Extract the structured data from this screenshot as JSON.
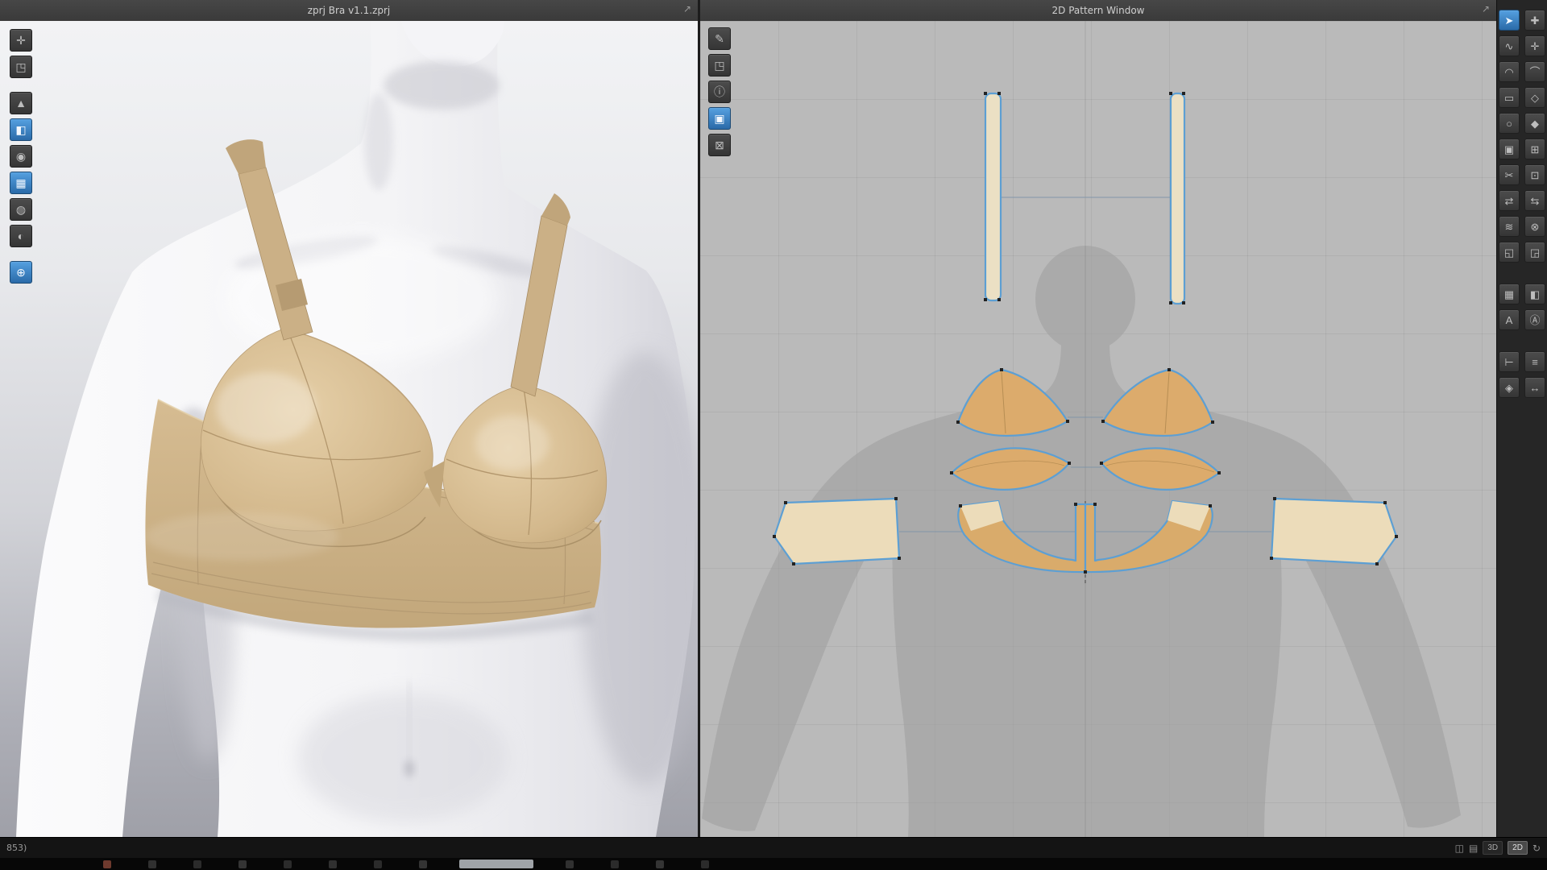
{
  "window": {
    "left_panel_title": "zprj Bra v1.1.zprj",
    "right_panel_title": "2D Pattern Window",
    "popout_glyph": "↗"
  },
  "statusbar": {
    "left_text": "853)",
    "layout_icon_1": "◫",
    "layout_icon_2": "▤",
    "view_3d": {
      "label": "3D",
      "active": false
    },
    "view_2d": {
      "label": "2D",
      "active": true
    },
    "refresh_glyph": "↻"
  },
  "colors": {
    "accent_blue": "#5d9fd3",
    "pattern_light": "#ecdcba",
    "pattern_dark": "#d9ab6b",
    "bra_band": "#cdb287",
    "skin": "#f5f5f7",
    "background_2d": "#bababa",
    "toolbar_bg": "#262626"
  },
  "toolbar_3d": {
    "items": [
      {
        "name": "simulate",
        "glyph": "✛",
        "active": false
      },
      {
        "name": "garment-display",
        "glyph": "◳",
        "active": false
      },
      {
        "name": "select-move",
        "glyph": "▲",
        "active": false
      },
      {
        "name": "pin-tool",
        "glyph": "◧",
        "active": true
      },
      {
        "name": "avatar-display",
        "glyph": "◉",
        "active": false
      },
      {
        "name": "fabric-texture",
        "glyph": "▦",
        "active": true
      },
      {
        "name": "stitch-display",
        "glyph": "◍",
        "active": false
      },
      {
        "name": "thickness-display",
        "glyph": "◐",
        "active": false
      },
      {
        "name": "world-axis",
        "glyph": "⊕",
        "active": true
      }
    ]
  },
  "toolbar_2d": {
    "items": [
      {
        "name": "edit-pattern",
        "glyph": "✎",
        "active": false
      },
      {
        "name": "pattern-display",
        "glyph": "◳",
        "active": false
      },
      {
        "name": "pattern-info",
        "glyph": "ⓘ",
        "active": false
      },
      {
        "name": "sync-3d",
        "glyph": "▣",
        "active": true
      },
      {
        "name": "lock-pattern",
        "glyph": "⊠",
        "active": false
      }
    ]
  },
  "toolbar_right": {
    "items": [
      {
        "name": "transform-pattern",
        "glyph": "➤",
        "active": true
      },
      {
        "name": "create-polygon",
        "glyph": "✚",
        "active": false
      },
      {
        "name": "edit-curvature",
        "glyph": "∿",
        "active": false
      },
      {
        "name": "add-point",
        "glyph": "✛",
        "active": false
      },
      {
        "name": "edit-arc",
        "glyph": "◠",
        "active": false
      },
      {
        "name": "curve-tool",
        "glyph": "⌒",
        "active": false
      },
      {
        "name": "create-rectangle",
        "glyph": "▭",
        "active": false
      },
      {
        "name": "create-dart",
        "glyph": "◇",
        "active": false
      },
      {
        "name": "create-circle",
        "glyph": "○",
        "active": false
      },
      {
        "name": "dart-tool",
        "glyph": "◆",
        "active": false
      },
      {
        "name": "seam-allowance",
        "glyph": "▣",
        "active": false
      },
      {
        "name": "internal-grid",
        "glyph": "⊞",
        "active": false
      },
      {
        "name": "cut-tool",
        "glyph": "✂",
        "active": false
      },
      {
        "name": "trace-tool",
        "glyph": "⊡",
        "active": false
      },
      {
        "name": "segment-sewing",
        "glyph": "⇄",
        "active": false
      },
      {
        "name": "free-sewing",
        "glyph": "⇆",
        "active": false
      },
      {
        "name": "mn-sewing",
        "glyph": "≋",
        "active": false
      },
      {
        "name": "remove-sewing",
        "glyph": "⊗",
        "active": false
      },
      {
        "name": "fold-arrangement",
        "glyph": "◱",
        "active": false
      },
      {
        "name": "unfold-arrangement",
        "glyph": "◲",
        "active": false
      },
      {
        "name": "edit-texture",
        "glyph": "▦",
        "active": false
      },
      {
        "name": "add-graphic",
        "glyph": "◧",
        "active": false
      },
      {
        "name": "add-text",
        "glyph": "A",
        "active": false
      },
      {
        "name": "grading",
        "glyph": "Ⓐ",
        "active": false
      },
      {
        "name": "measure",
        "glyph": "⊢",
        "active": false
      },
      {
        "name": "tape-tool",
        "glyph": "≡",
        "active": false
      },
      {
        "name": "pattern-symmetry",
        "glyph": "◈",
        "active": false
      },
      {
        "name": "flip-tool",
        "glyph": "↔",
        "active": false
      }
    ]
  },
  "taskbar": {
    "items": [
      {
        "style": "margin-left:128px;background:#6e3a2e"
      },
      {
        "style": "margin-left:46px;background:#303030"
      },
      {
        "style": "margin-left:46px;background:#2b2b2b"
      },
      {
        "style": "margin-left:46px;background:#343434"
      },
      {
        "style": "margin-left:46px;background:#2b2b2b"
      },
      {
        "style": "margin-left:46px;background:#303030"
      },
      {
        "style": "margin-left:46px;background:#2b2b2b"
      },
      {
        "style": "margin-left:46px;background:#343434"
      },
      {
        "style": "margin-left:40px;background:#9fa3a8;width:92px;height:11px"
      },
      {
        "style": "margin-left:40px;background:#303030"
      },
      {
        "style": "margin-left:46px;background:#2b2b2b"
      },
      {
        "style": "margin-left:46px;background:#343434"
      },
      {
        "style": "margin-left:46px;background:#2b2b2b"
      }
    ]
  }
}
